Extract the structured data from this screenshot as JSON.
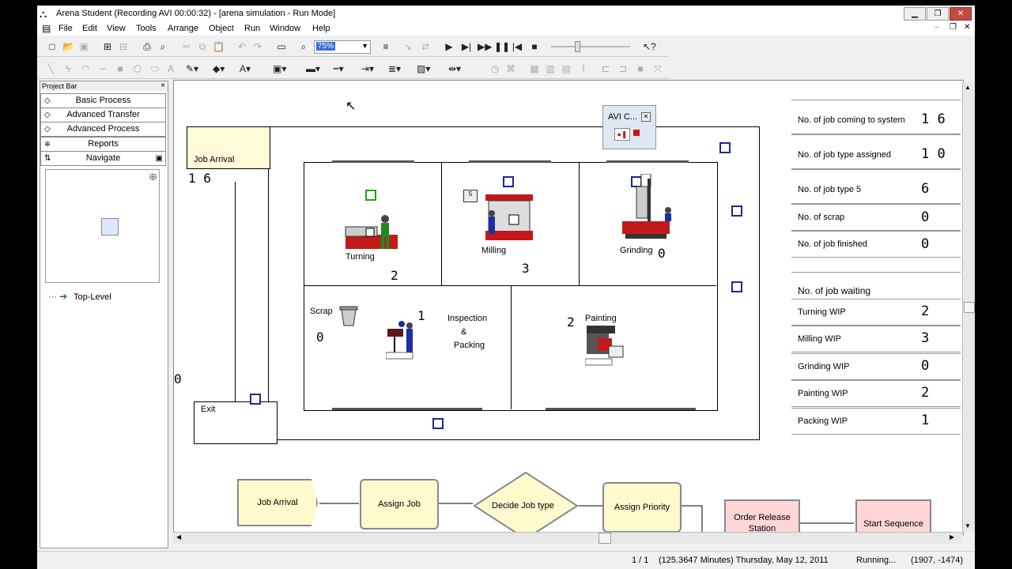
{
  "window": {
    "title": "Arena Student (Recording AVI 00:00:32) - [arena simulation - Run Mode]"
  },
  "menu": [
    "File",
    "Edit",
    "View",
    "Tools",
    "Arrange",
    "Object",
    "Run",
    "Window",
    "Help"
  ],
  "toolbar": {
    "zoom_value": "75%"
  },
  "project_bar": {
    "title": "Project Bar",
    "close": "×",
    "panels": [
      "Basic Process",
      "Advanced Transfer",
      "Advanced Process",
      "Reports",
      "Navigate"
    ],
    "tree_item": "Top-Level"
  },
  "avi_widget": {
    "title": "AVI C..."
  },
  "model": {
    "job_arrival_label": "Job Arrival",
    "job_arrival_count": "1 6",
    "exit_label": "Exit",
    "left_counter": "0",
    "stations": [
      {
        "name": "Turning",
        "count": "2"
      },
      {
        "name": "Milling",
        "count": "3"
      },
      {
        "name": "Grinding",
        "count": "0"
      },
      {
        "name": "Painting",
        "count": "2"
      }
    ],
    "scrap_label": "Scrap",
    "scrap_count": "0",
    "inspection_label_1": "Inspection",
    "inspection_label_2": "&",
    "inspection_label_3": "Packing",
    "inspection_count": "1",
    "part_label": "5"
  },
  "stats": {
    "rows": [
      {
        "label": "No. of job coming to system",
        "value": "1 6"
      },
      {
        "label": "No. of job type assigned",
        "value": "1 0"
      },
      {
        "label": "No. of job type 5",
        "value": "6"
      },
      {
        "label": "No. of scrap",
        "value": "0"
      },
      {
        "label": "No. of job finished",
        "value": "0"
      }
    ],
    "wip_header": "No. of job waiting",
    "wip_rows": [
      {
        "label": "Turning WIP",
        "value": "2"
      },
      {
        "label": "Milling WIP",
        "value": "3"
      },
      {
        "label": "Grinding WIP",
        "value": "0"
      },
      {
        "label": "Painting WIP",
        "value": "2"
      },
      {
        "label": "Packing WIP",
        "value": "1"
      }
    ]
  },
  "flowchart": {
    "modules": [
      "Job Arrival",
      "Assign Job",
      "Decide Job type",
      "Assign Priority",
      "Order Release Station",
      "Start Sequence"
    ]
  },
  "status": {
    "page": "1 / 1",
    "sim_time": "(125.3647 Minutes) Thursday, May 12, 2011",
    "state": "Running...",
    "coords": "(1907, -1474)"
  },
  "colors": {
    "module_fill": "#fffacd",
    "pink_module": "#ffd6d6",
    "queue_marker": "#1b2a8c",
    "machine_red": "#c21a1a"
  }
}
